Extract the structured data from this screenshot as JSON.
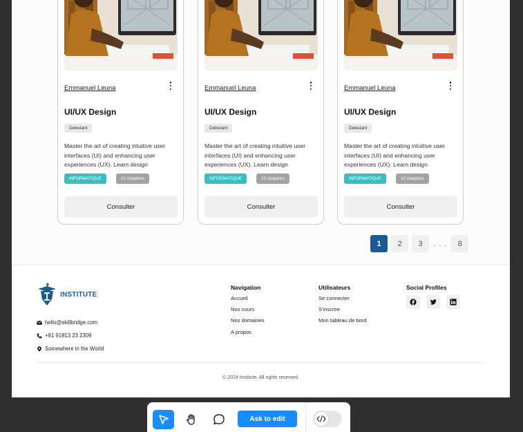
{
  "cards": [
    {
      "author": "Emmanuel Leuna",
      "title": "UI/UX Design",
      "level": "Debutant",
      "description": "Master the art of creating intuitive user interfaces (UI) and enhancing user experiences (UX). Learn design",
      "tag_category": "INFORMATIQUE",
      "tag_chapters": "12 chapitres",
      "button": "Consulter"
    },
    {
      "author": "Emmanuel Leuna",
      "title": "UI/UX Design",
      "level": "Debutant",
      "description": "Master the art of creating intuitive user interfaces (UI) and enhancing user experiences (UX). Learn design",
      "tag_category": "INFORMATIQUE",
      "tag_chapters": "12 chapitres",
      "button": "Consulter"
    },
    {
      "author": "Emmanuel Leuna",
      "title": "UI/UX Design",
      "level": "Debutant",
      "description": "Master the art of creating intuitive user interfaces (UI) and enhancing user experiences (UX). Learn design",
      "tag_category": "INFORMATIQUE",
      "tag_chapters": "12 chapitres",
      "button": "Consulter"
    }
  ],
  "pagination": {
    "pages": [
      "1",
      "2",
      "3"
    ],
    "dots": ". . .",
    "last": "8",
    "current": "1"
  },
  "footer": {
    "brand": "INSTITUTE",
    "email": "hello@skillbridge.com",
    "phone": "+91 91813 23 2309",
    "location": "Somewhere in the World",
    "navigation": {
      "heading": "Navigation",
      "links": [
        "Accueil",
        "Nos cours",
        "Nos domaines",
        "A propos"
      ]
    },
    "users": {
      "heading": "Utilisateurs",
      "links": [
        "Se connecter",
        "S'inscrire",
        "Mon tableau de bord"
      ]
    },
    "social": {
      "heading": "Social Profiles",
      "icons": [
        "facebook-icon",
        "twitter-icon",
        "linkedin-icon"
      ]
    },
    "copyright": "© 2024 Institute. All rights reserved."
  },
  "toolbar": {
    "ask_label": "Ask to edit"
  },
  "colors": {
    "primary": "#1d5a8f",
    "accent": "#1a8cff",
    "tag": "#3dbdbf"
  }
}
